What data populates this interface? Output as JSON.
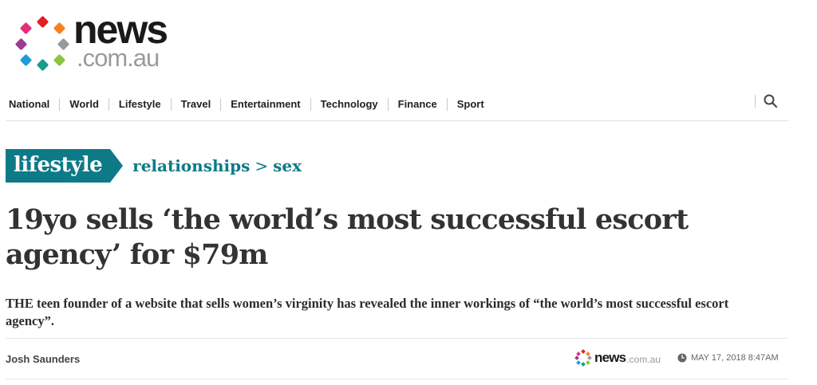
{
  "brand": {
    "name": "news",
    "domain": ".com.au",
    "dot_colors": [
      "#e02020",
      "#f5821f",
      "#8cc63f",
      "#1f9bd7",
      "#9b3c97",
      "#e4307c",
      "#999999",
      "#1a9b8b"
    ]
  },
  "nav": {
    "items": [
      "National",
      "World",
      "Lifestyle",
      "Travel",
      "Entertainment",
      "Technology",
      "Finance",
      "Sport"
    ],
    "search_icon": "search-icon"
  },
  "section": {
    "tag": "lifestyle",
    "crumb1": "relationships",
    "separator": ">",
    "crumb2": "sex",
    "color": "#0d7a87"
  },
  "article": {
    "headline": "19yo sells ‘the world’s most successful escort agency’ for $79m",
    "standfirst": "THE teen founder of a website that sells women’s virginity has revealed the inner workings of “the world’s most successful escort agency”.",
    "author": "Josh Saunders",
    "source_news": "news",
    "source_domain": ".com.au",
    "clock_icon": "clock-icon",
    "date": "MAY 17, 2018 8:47AM"
  }
}
